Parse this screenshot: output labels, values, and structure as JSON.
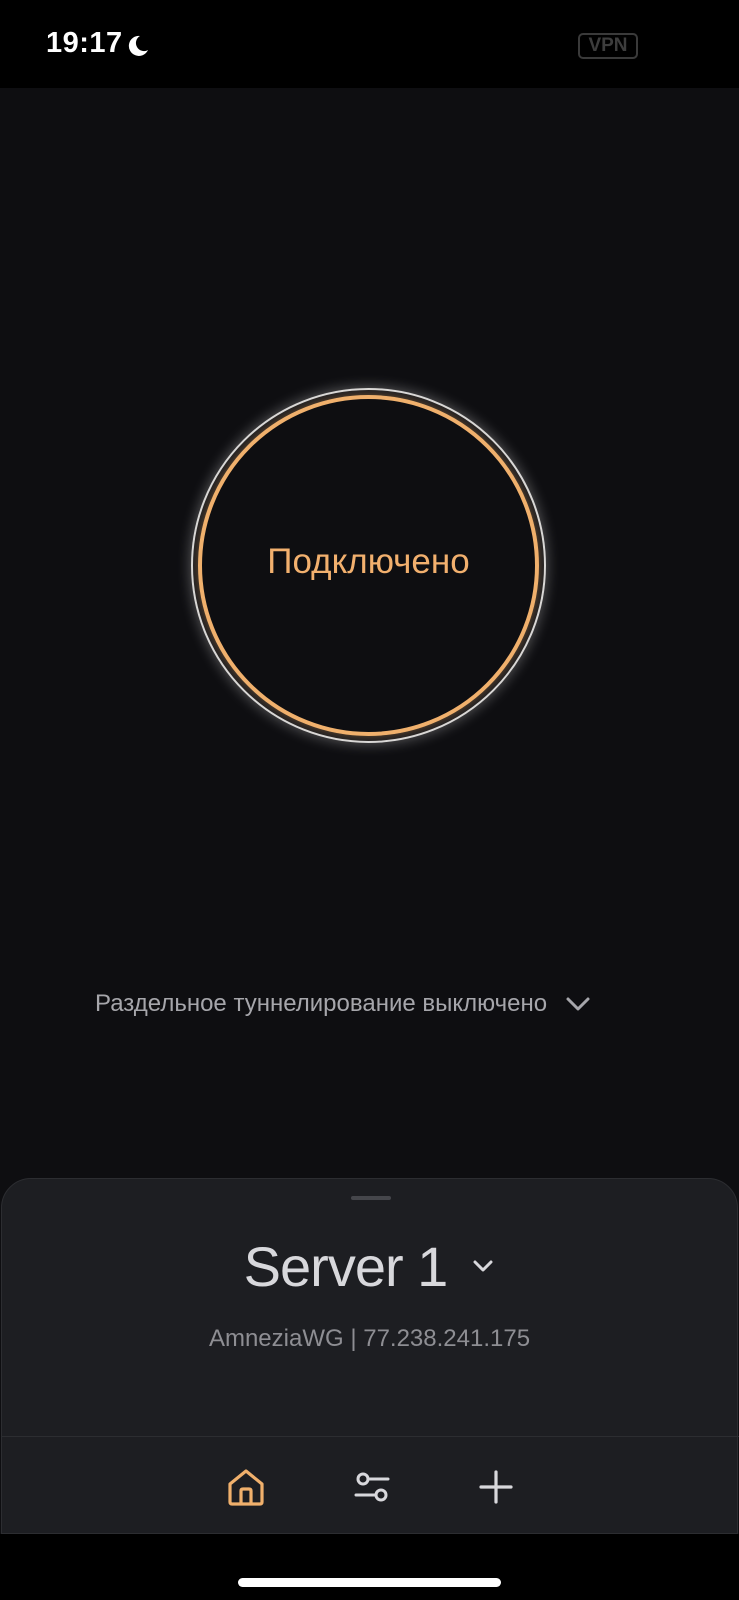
{
  "status_bar": {
    "time": "19:17",
    "moon_icon": "moon-icon",
    "vpn_badge": "VPN"
  },
  "connection": {
    "status_label": "Подключено",
    "ring_color": "#f0b06c"
  },
  "split_tunneling": {
    "label": "Раздельное туннелирование выключено",
    "icon": "chevron-down-icon"
  },
  "server": {
    "name": "Server 1",
    "info": "AmneziaWG | 77.238.241.175",
    "icon": "chevron-down-icon"
  },
  "tab_bar": {
    "tabs": [
      {
        "name": "home",
        "icon": "home-icon",
        "active": true
      },
      {
        "name": "settings",
        "icon": "sliders-icon",
        "active": false
      },
      {
        "name": "add",
        "icon": "plus-icon",
        "active": false
      }
    ],
    "active_color": "#f0b06c",
    "inactive_color": "#d8d8dc"
  },
  "colors": {
    "background": "#0e0e11",
    "sheet": "#1d1e22",
    "accent": "#f2b06e"
  }
}
